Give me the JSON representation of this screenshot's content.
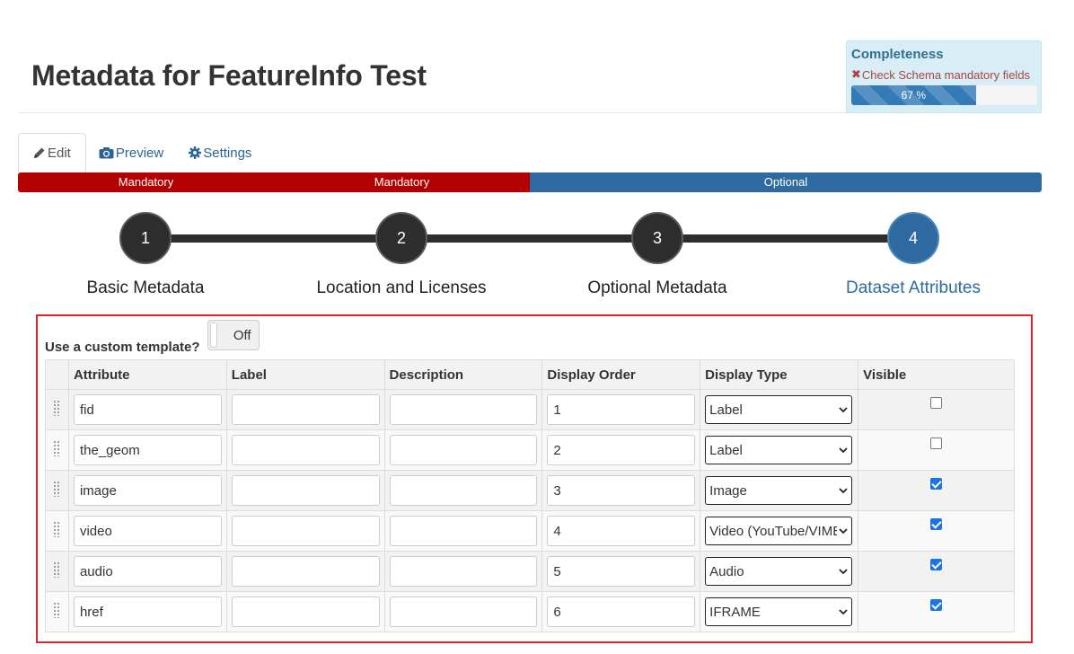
{
  "page": {
    "title": "Metadata for FeatureInfo Test"
  },
  "completeness": {
    "title": "Completeness",
    "check_label": "Check Schema mandatory fields",
    "progress_text": "67 %",
    "progress_fraction": 0.67
  },
  "tabs": [
    {
      "label": "Edit",
      "icon": "pencil-icon",
      "active": true
    },
    {
      "label": "Preview",
      "icon": "camera-icon",
      "active": false
    },
    {
      "label": "Settings",
      "icon": "gear-icon",
      "active": false
    }
  ],
  "step_bar": [
    {
      "label": "Mandatory",
      "color": "#b30000"
    },
    {
      "label": "Mandatory",
      "color": "#b30000"
    },
    {
      "label": "Optional",
      "color": "#2e6aa0"
    }
  ],
  "wizard": {
    "steps": [
      {
        "number": "1",
        "label": "Basic Metadata"
      },
      {
        "number": "2",
        "label": "Location and Licenses"
      },
      {
        "number": "3",
        "label": "Optional Metadata"
      },
      {
        "number": "4",
        "label": "Dataset Attributes"
      }
    ],
    "current_step": 4
  },
  "attributes": {
    "custom_template_label": "Use a custom template?",
    "toggle_label": "Off",
    "columns": [
      "Attribute",
      "Label",
      "Description",
      "Display Order",
      "Display Type",
      "Visible"
    ],
    "rows": [
      {
        "attribute": "fid",
        "label": "",
        "description": "",
        "order": "1",
        "display_type": "Label",
        "visible": false
      },
      {
        "attribute": "the_geom",
        "label": "",
        "description": "",
        "order": "2",
        "display_type": "Label",
        "visible": false
      },
      {
        "attribute": "image",
        "label": "",
        "description": "",
        "order": "3",
        "display_type": "Image",
        "visible": true
      },
      {
        "attribute": "video",
        "label": "",
        "description": "",
        "order": "4",
        "display_type": "Video (YouTube/VIMEO)",
        "visible": true
      },
      {
        "attribute": "audio",
        "label": "",
        "description": "",
        "order": "5",
        "display_type": "Audio",
        "visible": true
      },
      {
        "attribute": "href",
        "label": "",
        "description": "",
        "order": "6",
        "display_type": "IFRAME",
        "visible": true
      }
    ]
  },
  "colors": {
    "accent": "#2e6aa0",
    "mandatory": "#b30000",
    "highlight_border": "#d9262b"
  }
}
